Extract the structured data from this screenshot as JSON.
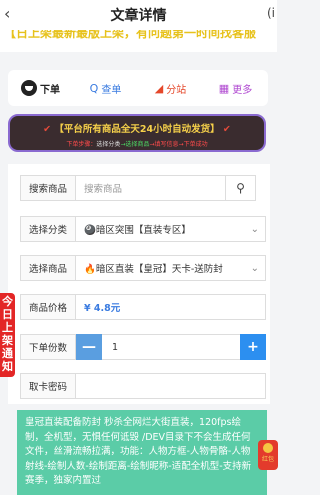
{
  "nav": {
    "back_icon": "back-arrow-icon",
    "title": "文章详情",
    "more_text": "(i"
  },
  "banner": {
    "text": "【日上架最新最版上架，有问题第一时间找客服"
  },
  "tabs": [
    {
      "label": "下单",
      "icon": "avatar-icon"
    },
    {
      "label": "查单",
      "icon": "search-icon",
      "glyph": "Q"
    },
    {
      "label": "分站",
      "icon": "send-icon",
      "glyph": "◢"
    },
    {
      "label": "更多",
      "icon": "grid-icon",
      "glyph": "▦"
    }
  ],
  "notice": {
    "headline": "【平台所有商品全天24小时自动发货】",
    "steps": [
      "下单步骤：",
      "选择分类",
      "选择商品",
      "填写信息",
      "下单成功"
    ]
  },
  "form": {
    "search_label": "搜索商品",
    "search_placeholder": "搜索商品",
    "category_label": "选择分类",
    "category_value": "🎱暗区突围【直装专区】",
    "product_label": "选择商品",
    "product_value": "🔥暗区直装【皇冠】天卡-送防封",
    "price_label": "商品价格",
    "price_value": "¥ 4.8元",
    "qty_label": "下单份数",
    "qty_value": "1",
    "minus": "—",
    "plus": "+",
    "code_label": "取卡密码"
  },
  "description": "皇冠直装配备防封 秒杀全网烂大街直装，120fps绘制，全机型，无惧任何诋毁 /DEV目录下不会生成任何文件，丝滑流畅拉满，功能：人物方框-人物骨骼-人物射线-绘制人数-绘制距离-绘制昵称-适配全机型-支持新赛季，独家内置过",
  "side_badge": "今日上架通知",
  "redpack": "红包"
}
